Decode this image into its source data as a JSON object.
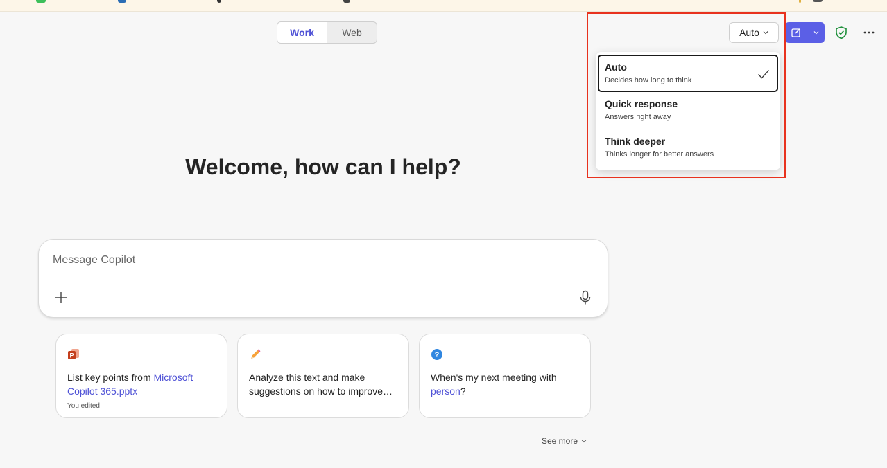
{
  "mode_toggle": {
    "options": [
      "Work",
      "Web"
    ],
    "selected": "Work"
  },
  "response_mode": {
    "button_label": "Auto",
    "items": [
      {
        "title": "Auto",
        "description": "Decides how long to think",
        "selected": true
      },
      {
        "title": "Quick response",
        "description": "Answers right away",
        "selected": false
      },
      {
        "title": "Think deeper",
        "description": "Thinks longer for better answers",
        "selected": false
      }
    ]
  },
  "toolbar": {
    "new_chat_icon": "compose-icon",
    "shield_icon": "shield-check-icon",
    "more_icon": "more-horizontal-icon"
  },
  "welcome": {
    "heading": "Welcome, how can I help?"
  },
  "composer": {
    "placeholder": "Message Copilot",
    "value": ""
  },
  "suggestions": [
    {
      "icon": "powerpoint-icon",
      "text_before": "List key points from ",
      "link": "Microsoft Copilot 365.pptx",
      "text_after": "",
      "meta": "You edited"
    },
    {
      "icon": "pencil-icon",
      "text_before": "Analyze this text and make suggestions on how to improve…",
      "link": "",
      "text_after": "",
      "meta": ""
    },
    {
      "icon": "question-icon",
      "text_before": "When's my next meeting with ",
      "link": "person",
      "text_after": "?",
      "meta": ""
    }
  ],
  "see_more": {
    "label": "See more"
  },
  "colors": {
    "accent": "#5b5fe6",
    "link": "#4f52d6",
    "highlight": "#e8321e",
    "shield": "#1e8f3a",
    "background": "#f7f7f7"
  }
}
